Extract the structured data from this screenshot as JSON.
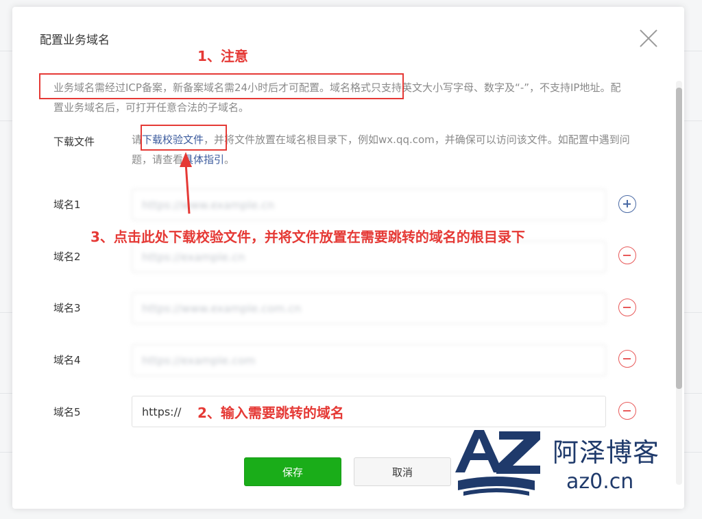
{
  "dialog": {
    "title": "配置业务域名",
    "notice_highlighted": "业务域名需经过ICP备案，新备案域名需24小时后才可配置。",
    "notice_rest": "域名格式只支持英文大小写字母、数字及“-”，不支持IP地址。配置业务域名后，可打开任意合法的子域名。",
    "download": {
      "label": "下载文件",
      "prefix": "请",
      "link_text": "下载校验文件",
      "middle": "，并将文件放置在域名根目录下，例如wx.qq.com，并确保可以访问该文件。如配置中遇到问题，请查看",
      "guide_link": "具体指引",
      "suffix": "。"
    },
    "domains": [
      {
        "label": "域名1",
        "value": "https://www.example.cn",
        "action": "add"
      },
      {
        "label": "域名2",
        "value": "https://example.cn",
        "action": "remove"
      },
      {
        "label": "域名3",
        "value": "https://www.example.com.cn",
        "action": "remove"
      },
      {
        "label": "域名4",
        "value": "https://example.com",
        "action": "remove"
      },
      {
        "label": "域名5",
        "value": "https://",
        "action": "remove"
      }
    ],
    "buttons": {
      "save": "保存",
      "cancel": "取消"
    }
  },
  "annotations": {
    "note1": "1、注意",
    "note2": "2、输入需要跳转的域名",
    "note3": "3、点击此处下载校验文件，并将文件放置在需要跳转的域名的根目录下"
  },
  "watermark": {
    "name": "阿泽博客",
    "domain": "az0.cn",
    "logo_text": "AZ"
  },
  "colors": {
    "accent_green": "#1aad19",
    "link_blue": "#3d5c9e",
    "annotation_red": "#e53935",
    "watermark_navy": "#1f3a6b"
  }
}
